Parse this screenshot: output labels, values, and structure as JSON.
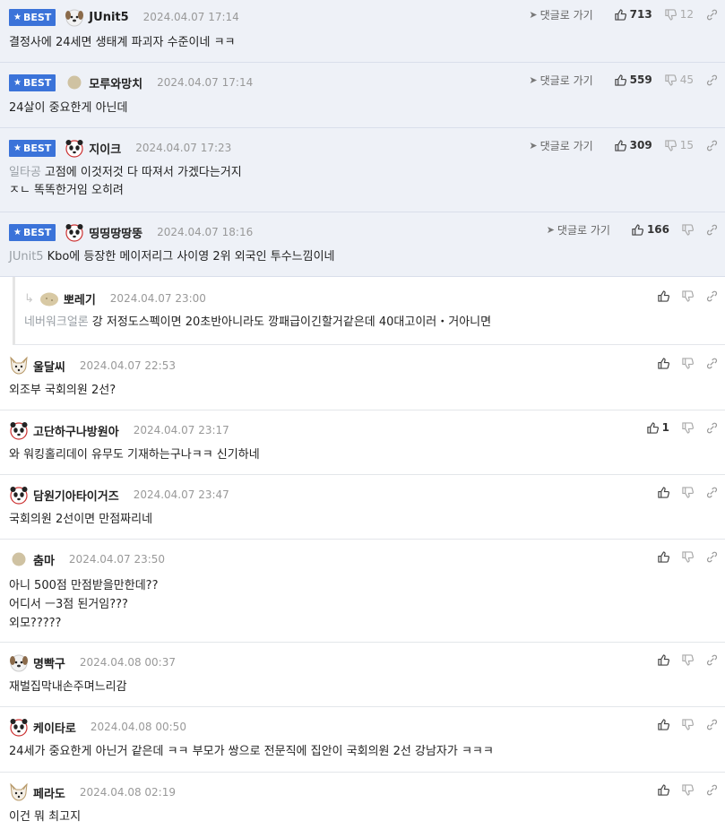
{
  "labels": {
    "best": "BEST",
    "goto_reply": "댓글로 가기"
  },
  "colors": {
    "best_badge": "#3b73d9",
    "best_bg": "#eef1f7"
  },
  "comments": [
    {
      "best": true,
      "avatar": "dog-avatar",
      "nick": "JUnit5",
      "time": "2024.04.07 17:14",
      "text": "결정사에 24세면 생태계 파괴자 수준이네 ㅋㅋ",
      "up": "713",
      "down": "12"
    },
    {
      "best": true,
      "avatar": "dot-avatar",
      "nick": "모루와망치",
      "time": "2024.04.07 17:14",
      "text": "24살이 중요한게 아닌데",
      "up": "559",
      "down": "45"
    },
    {
      "best": true,
      "avatar": "panda-avatar",
      "nick": "지이크",
      "time": "2024.04.07 17:23",
      "mention": "일타공",
      "text": "고점에 이것저것 다 따져서 가겠다는거지\nㅈㄴ 똑똑한거임 오히려",
      "up": "309",
      "down": "15"
    },
    {
      "best": true,
      "avatar": "panda-avatar",
      "nick": "띵띵땅땅뚱",
      "time": "2024.04.07 18:16",
      "mention": "JUnit5",
      "text": "Kbo에 등장한 메이저리그 사이영 2위 외국인 투수느낌이네",
      "up": "166",
      "down": ""
    },
    {
      "reply": true,
      "avatar": "potato-avatar",
      "nick": "뽀레기",
      "time": "2024.04.07 23:00",
      "mention": "네버워크얼론",
      "text": "강 저정도스펙이면 20초반아니라도 깡패급이긴할거같은데 40대고이러・거아니면",
      "up": "",
      "down": ""
    },
    {
      "avatar": "fox-avatar",
      "nick": "울달씨",
      "time": "2024.04.07 22:53",
      "text": "외조부 국회의원 2선?",
      "up": "",
      "down": ""
    },
    {
      "avatar": "panda-avatar",
      "nick": "고단하구나방원아",
      "time": "2024.04.07 23:17",
      "text": "와 워킹홀리데이 유무도 기재하는구나ㅋㅋ 신기하네",
      "up": "1",
      "down": ""
    },
    {
      "avatar": "panda-avatar",
      "nick": "담원기아타이거즈",
      "time": "2024.04.07 23:47",
      "text": "국회의원 2선이면 만점짜리네",
      "up": "",
      "down": ""
    },
    {
      "avatar": "dot-avatar",
      "nick": "춤마",
      "time": "2024.04.07 23:50",
      "text": "아니 500점 만점받을만한데??\n어디서 ㅡ3점 된거임???\n외모?????",
      "up": "",
      "down": ""
    },
    {
      "avatar": "dog-avatar",
      "nick": "명빡구",
      "time": "2024.04.08 00:37",
      "text": "재벌집막내손주며느리감",
      "up": "",
      "down": ""
    },
    {
      "avatar": "panda-avatar",
      "nick": "케이타로",
      "time": "2024.04.08 00:50",
      "text": "24세가 중요한게 아닌거 같은데 ㅋㅋ 부모가 쌍으로 전문직에 집안이 국회의원 2선 강남자가 ㅋㅋㅋ",
      "up": "",
      "down": ""
    },
    {
      "avatar": "fox-avatar",
      "nick": "페라도",
      "time": "2024.04.08 02:19",
      "text": "이건 뭐 최고지",
      "up": "",
      "down": ""
    }
  ]
}
